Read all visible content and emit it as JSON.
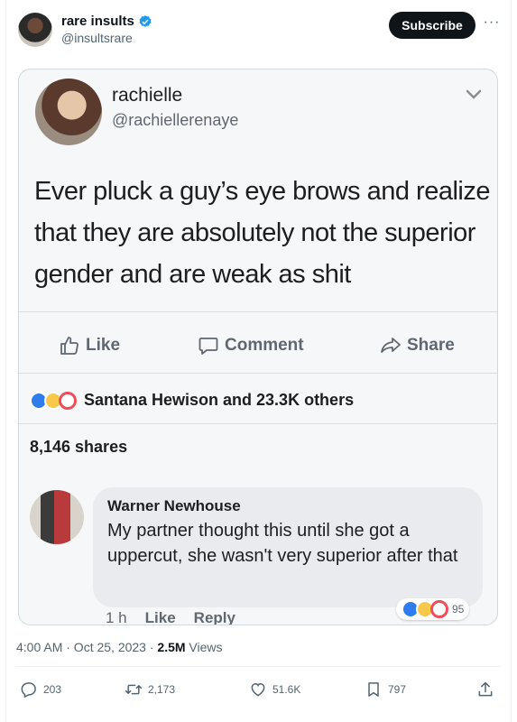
{
  "tweet": {
    "author_name": "rare insults",
    "author_handle": "@insultsrare",
    "subscribe_label": "Subscribe",
    "timestamp": "4:00 AM · Oct 25, 2023 · ",
    "views_count": "2.5M",
    "views_label": " Views"
  },
  "embedded_post": {
    "name": "rachielle",
    "handle": "@rachiellerenaye",
    "text": "Ever pluck a guy’s eye brows and realize that they are absolutely not the superior gender and are weak as shit",
    "actions": {
      "like": "Like",
      "comment": "Comment",
      "share": "Share"
    },
    "reactions_text": "Santana Hewison and 23.3K others",
    "shares": "8,146 shares",
    "comment": {
      "author": "Warner Newhouse",
      "text": "My partner thought this until she got a uppercut, she wasn't very superior after that",
      "time": "1 h",
      "like": "Like",
      "reply": "Reply",
      "reaction_count": "95"
    }
  },
  "actions": {
    "replies": "203",
    "reposts": "2,173",
    "likes": "51.6K",
    "bookmarks": "797"
  },
  "colors": {
    "verified": "#1d9bf0",
    "subscribe_bg": "#0f1419",
    "fb_like": "#2f7ded",
    "fb_love": "#ef4d5a",
    "fb_haha": "#f7c84a"
  }
}
